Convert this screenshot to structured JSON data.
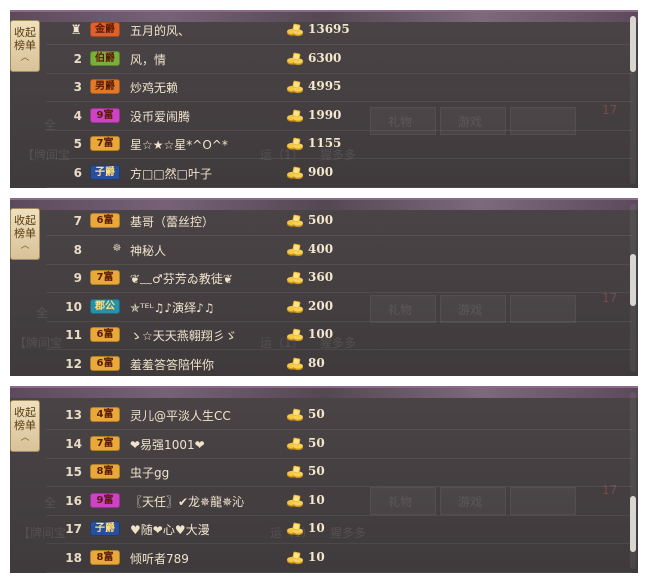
{
  "panels": [
    {
      "toggle": {
        "line1": "收起",
        "line2": "榜单",
        "arrow": "︿"
      },
      "ghost": {
        "left_label": "全",
        "tab1": "礼物",
        "tab2": "游戏",
        "count": "17",
        "notice": "【牌间宝",
        "notice_tail": "运（1）",
        "notice_tail2": "猩多多"
      },
      "rows": [
        {
          "rank": "1",
          "badge": "金爵",
          "badge_color": "#e0602c",
          "name": "五月的风、",
          "amount": "13695"
        },
        {
          "rank": "2",
          "badge": "伯爵",
          "badge_color": "#7ab03a",
          "name": "风，情",
          "amount": "6300"
        },
        {
          "rank": "3",
          "badge": "男爵",
          "badge_color": "#e07a2a",
          "name": "炒鸡无赖",
          "amount": "4995"
        },
        {
          "rank": "4",
          "badge": "9富",
          "badge_color": "#cc44c4",
          "name": "没币爱闹腾",
          "amount": "1990"
        },
        {
          "rank": "5",
          "badge": "7富",
          "badge_color": "#e9a83a",
          "name": "星☆★☆星*^O^*",
          "amount": "1155"
        },
        {
          "rank": "6",
          "badge": "子爵",
          "badge_color": "#2a4f9a",
          "name": "方□□然□叶子",
          "amount": "900"
        }
      ]
    },
    {
      "toggle": {
        "line1": "收起",
        "line2": "榜单",
        "arrow": "︿"
      },
      "ghost": {
        "left_label": "全",
        "tab1": "礼物",
        "tab2": "游戏",
        "count": "17",
        "notice": "【牌间宝",
        "notice_tail": "运（1）",
        "notice_tail2": "猩多多"
      },
      "rows": [
        {
          "rank": "7",
          "badge": "6富",
          "badge_color": "#e9a83a",
          "name": "基哥（蕾丝控）",
          "amount": "500"
        },
        {
          "rank": "8",
          "badge": "",
          "badge_color": "",
          "name": "神秘人",
          "amount": "400"
        },
        {
          "rank": "9",
          "badge": "7富",
          "badge_color": "#e9a83a",
          "name": "❦﹏♂芬芳ゐ教徒❦",
          "amount": "360"
        },
        {
          "rank": "10",
          "badge": "郡公",
          "badge_color": "#2a8fa8",
          "name": "✯ᵀᴱᴸ♫♪演绎♪♫",
          "amount": "200"
        },
        {
          "rank": "11",
          "badge": "6富",
          "badge_color": "#e9a83a",
          "name": "ゝ☆天天燕翱翔彡ゞ",
          "amount": "100"
        },
        {
          "rank": "12",
          "badge": "6富",
          "badge_color": "#e9a83a",
          "name": "羞羞答答陪伴你",
          "amount": "80"
        }
      ]
    },
    {
      "toggle": {
        "line1": "收起",
        "line2": "榜单",
        "arrow": "︿"
      },
      "ghost": {
        "left_label": "全",
        "tab1": "礼物",
        "tab2": "游戏",
        "count": "17",
        "notice": "【牌间宝",
        "notice_tail": "运（1）",
        "notice_tail2": "猩多多"
      },
      "rows": [
        {
          "rank": "13",
          "badge": "4富",
          "badge_color": "#e9a83a",
          "name": "灵儿@平淡人生CC",
          "amount": "50"
        },
        {
          "rank": "14",
          "badge": "7富",
          "badge_color": "#e9a83a",
          "name": "❤易强1001❤",
          "amount": "50"
        },
        {
          "rank": "15",
          "badge": "8富",
          "badge_color": "#e9a83a",
          "name": "虫子gg",
          "amount": "50"
        },
        {
          "rank": "16",
          "badge": "9富",
          "badge_color": "#cc44c4",
          "name": "〖天任〗✔龙✵龍✵沁",
          "amount": "10"
        },
        {
          "rank": "17",
          "badge": "子爵",
          "badge_color": "#2a4f9a",
          "name": "♥随❤心♥大漫",
          "amount": "10"
        },
        {
          "rank": "18",
          "badge": "8富",
          "badge_color": "#e9a83a",
          "name": "倾听者789",
          "amount": "10"
        }
      ]
    }
  ]
}
